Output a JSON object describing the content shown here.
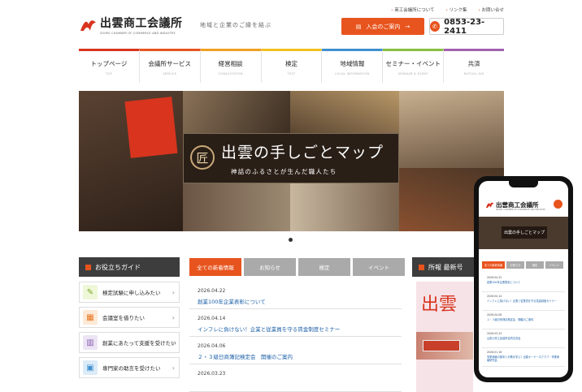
{
  "header": {
    "logo_title": "出雲商工会議所",
    "logo_sub": "IZUMO CHAMBER OF COMMERCE AND INDUSTRY",
    "tagline": "地域と企業のご縁を結ぶ",
    "top_links": [
      "商工会議所について",
      "リンク集",
      "お問い合せ"
    ],
    "join_label": "入会のご案内",
    "phone": "0853-23-2411"
  },
  "nav": [
    {
      "label": "トップページ",
      "sub": "TOP",
      "color": "#d8341e"
    },
    {
      "label": "会議所サービス",
      "sub": "SERVICE",
      "color": "#e8541e"
    },
    {
      "label": "経営相談",
      "sub": "CONSULTATION",
      "color": "#f0a020"
    },
    {
      "label": "検定",
      "sub": "TEST",
      "color": "#f0c020"
    },
    {
      "label": "地域情報",
      "sub": "LOCAL INFORMATION",
      "color": "#3f8fd0"
    },
    {
      "label": "セミナー・イベント",
      "sub": "SEMINAR & EVENT",
      "color": "#8bbf40"
    },
    {
      "label": "共済",
      "sub": "MUTUAL AID",
      "color": "#a060b0"
    }
  ],
  "hero": {
    "badge": "匠",
    "title": "出雲の手しごとマップ",
    "subtitle": "神話のふるさとが生んだ職人たち"
  },
  "sidebar": {
    "title": "お役立ちガイド",
    "items": [
      {
        "label": "検定試験に申し込みたい",
        "icon": "pencil-icon",
        "bg": "#eef7d8",
        "fg": "#7ba82a",
        "glyph": "✎"
      },
      {
        "label": "会議室を借りたい",
        "icon": "room-icon",
        "bg": "#fde9d6",
        "fg": "#e8741e",
        "glyph": "▦"
      },
      {
        "label": "創業にあたって支援を受けたい",
        "icon": "building-icon",
        "bg": "#ece4f4",
        "fg": "#8a60b0",
        "glyph": "▥"
      },
      {
        "label": "専門家の助言を受けたい",
        "icon": "monitor-icon",
        "bg": "#dcebf8",
        "fg": "#3f8fd0",
        "glyph": "▣"
      }
    ]
  },
  "news": {
    "tabs": [
      {
        "label": "全ての新着情報",
        "color": "#e8541e",
        "w": 64
      },
      {
        "label": "お知らせ",
        "color": "#aaaaaa",
        "w": 64
      },
      {
        "label": "検定",
        "color": "#aaaaaa",
        "w": 64
      },
      {
        "label": "イベント",
        "color": "#aaaaaa",
        "w": 64
      }
    ],
    "items": [
      {
        "date": "2026.04.22",
        "text": "創業100年企業表彰について"
      },
      {
        "date": "2026.04.14",
        "text": "インフレに負けない！企業と従業員を守る賃金制度セミナー"
      },
      {
        "date": "2026.04.06",
        "text": "２・３級日商簿記検定会　開催のご案内"
      },
      {
        "date": "2026.03.23",
        "text": ""
      }
    ]
  },
  "right": {
    "title": "所報 最新号",
    "magazine_label": "出雲"
  },
  "mobile": {
    "logo": "出雲商工会議所",
    "logo_sub": "IZUMO CHAMBER OF COMMERCE AND INDUSTRY",
    "hero_title": "出雲の手しごとマップ",
    "tabs": [
      "全ての新着情報",
      "お知らせ",
      "検定",
      "イベント"
    ],
    "items": [
      {
        "date": "2026.04.22",
        "text": "創業100年企業表彰について"
      },
      {
        "date": "2026.04.14",
        "text": "インフレに負けない！企業と従業員を守る賃金制度セミナー"
      },
      {
        "date": "2026.04.06",
        "text": "２・３級日商簿記検定会　開催のご案内"
      },
      {
        "date": "2026.03.23",
        "text": "山陰七商工会議所合同交流会"
      },
      {
        "date": "2026.01.16",
        "text": "事業承継の基本と対策を学ぶ！出雲オーナーズクラブ・事業承継研究会"
      }
    ]
  }
}
